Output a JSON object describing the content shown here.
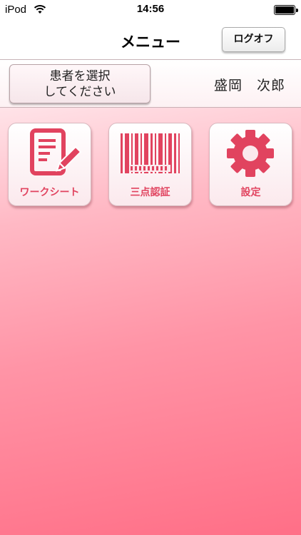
{
  "status_bar": {
    "carrier": "iPod",
    "time": "14:56",
    "icons": [
      "wifi-icon",
      "battery-icon"
    ]
  },
  "nav": {
    "title": "メニュー",
    "logoff_label": "ログオフ"
  },
  "patient": {
    "select_button_line1": "患者を選択",
    "select_button_line2": "してください",
    "name": "盛岡　次郎"
  },
  "menu": {
    "items": [
      {
        "label": "ワークシート",
        "icon": "worksheet-icon"
      },
      {
        "label": "三点認証",
        "icon": "barcode-icon"
      },
      {
        "label": "設定",
        "icon": "gear-icon"
      }
    ]
  },
  "colors": {
    "accent": "#e1435f",
    "background_top": "#ffe3e8",
    "background_bottom": "#ff6f87"
  }
}
